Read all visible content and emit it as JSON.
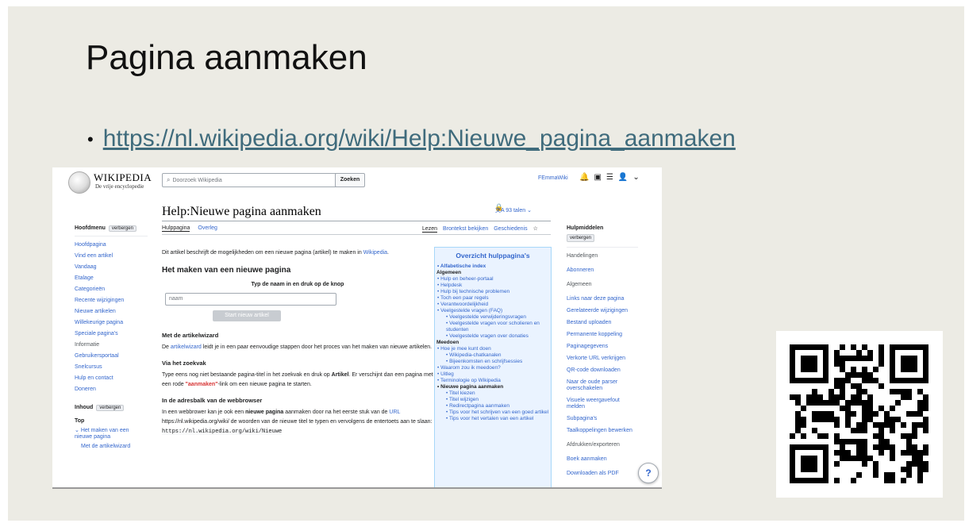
{
  "slide": {
    "title": "Pagina aanmaken",
    "bullet": "•",
    "link": "https://nl.wikipedia.org/wiki/Help:Nieuwe_pagina_aanmaken"
  },
  "wiki": {
    "logo_word": "WIKIPEDIA",
    "logo_tagline": "De vrije encyclopedie",
    "search_placeholder": "Doorzoek Wikipedia",
    "search_button": "Zoeken",
    "user": "FEmmaWiki",
    "page_title": "Help:Nieuwe pagina aanmaken",
    "languages": "93 talen",
    "tab_page": "Hulppagina",
    "tab_talk": "Overleg",
    "tab_read": "Lezen",
    "tab_source": "Brontekst bekijken",
    "tab_history": "Geschiedenis",
    "left": {
      "main_menu": "Hoofdmenu",
      "hide": "verbergen",
      "items": [
        "Hoofdpagina",
        "Vind een artikel",
        "Vandaag",
        "Etalage",
        "Categorieën",
        "Recente wijzigingen",
        "Nieuwe artikelen",
        "Willekeurige pagina",
        "Speciale pagina's"
      ],
      "info": "Informatie",
      "info_items": [
        "Gebruikersportaal",
        "Snelcursus",
        "Hulp en contact",
        "Doneren"
      ],
      "toc": "Inhoud",
      "toc_hide": "verbergen",
      "toc_top": "Top",
      "toc_items": [
        "Het maken van een nieuwe pagina",
        "Met de artikelwizard"
      ]
    },
    "content": {
      "intro_a": "Dit artikel beschrijft de mogelijkheden om een nieuwe pagina (artikel) te maken in ",
      "intro_link": "Wikipedia",
      "intro_b": ".",
      "h_make": "Het maken van een nieuwe pagina",
      "prompt": "Typ de naam in en druk op de knop",
      "input_placeholder": "naam",
      "start_button": "Start nieuw artikel",
      "h_wizard": "Met de artikelwizard",
      "wizard_a": "De ",
      "wizard_link": "artikelwizard",
      "wizard_b": " leidt je in een paar eenvoudige stappen door het proces van het maken van nieuwe artikelen.",
      "h_search": "Via het zoekvak",
      "search_a": "Type eens nog niet bestaande pagina-titel in het zoekvak en druk op ",
      "search_bold": "Artikel",
      "search_b": ". Er verschijnt dan een pagina met een rode ",
      "search_red": "\"aanmaken\"",
      "search_c": "-link om een nieuwe pagina te starten.",
      "h_address": "In de adresbalk van de webbrowser",
      "addr_a": "In een webbrower kan je ook een ",
      "addr_bold": "nieuwe pagina",
      "addr_b": " aanmaken door na het eerste stuk van de ",
      "addr_link": "URL",
      "addr_c": " https://nl.wikipedia.org/wiki/ de woorden van de nieuwe titel te typen en vervolgens de entertoets aan te slaan: ",
      "addr_code": "https://nl.wikipedia.org/wiki/Nieuwe"
    },
    "navbox": {
      "title": "Overzicht hulppagina's",
      "alpha": "Alfabetische index",
      "general": "Algemeen",
      "general_items": [
        "Hulp en beheer-portaal",
        "Helpdesk",
        "Hulp bij technische problemen",
        "Toch een paar regels",
        "Verantwoordelijkheid",
        "Veelgestelde vragen (FAQ)"
      ],
      "faq_items": [
        "Veelgestelde verwijderingsvragen",
        "Veelgestelde vragen voor scholieren en studenten",
        "Veelgestelde vragen over donaties"
      ],
      "participate": "Meedoen",
      "part_items_a": [
        "Hoe je mee kunt doen"
      ],
      "part_sub": [
        "Wikipedia-chatkanalen",
        "Bijeenkomsten en schrijfsessies"
      ],
      "part_items_b": [
        "Waarom zou ik meedoen?",
        "Uitleg",
        "Terminologie op Wikipedia"
      ],
      "new_page": "Nieuwe pagina aanmaken",
      "new_sub": [
        "Titel kiezen",
        "Titel wijzigen",
        "Redirectpagina aanmaken",
        "Tips voor het schrijven van een goed artikel",
        "Tips voor het vertalen van een artikel"
      ]
    },
    "right": {
      "tools": "Hulpmiddelen",
      "hide": "verbergen",
      "actions": "Handelingen",
      "subscribe": "Abonneren",
      "general": "Algemeen",
      "items": [
        "Links naar deze pagina",
        "Gerelateerde wijzigingen",
        "Bestand uploaden",
        "Permanente koppeling",
        "Paginagegevens",
        "Verkorte URL verkrijgen",
        "QR-code downloaden",
        "Naar de oude parser overschakelen",
        "Visuele weergavefout melden",
        "Subpagina's",
        "Taalkoppelingen bewerken"
      ],
      "print": "Afdrukken/exporteren",
      "book": "Boek aanmaken",
      "pdf": "Downloaden als PDF"
    },
    "help_icon": "?"
  }
}
